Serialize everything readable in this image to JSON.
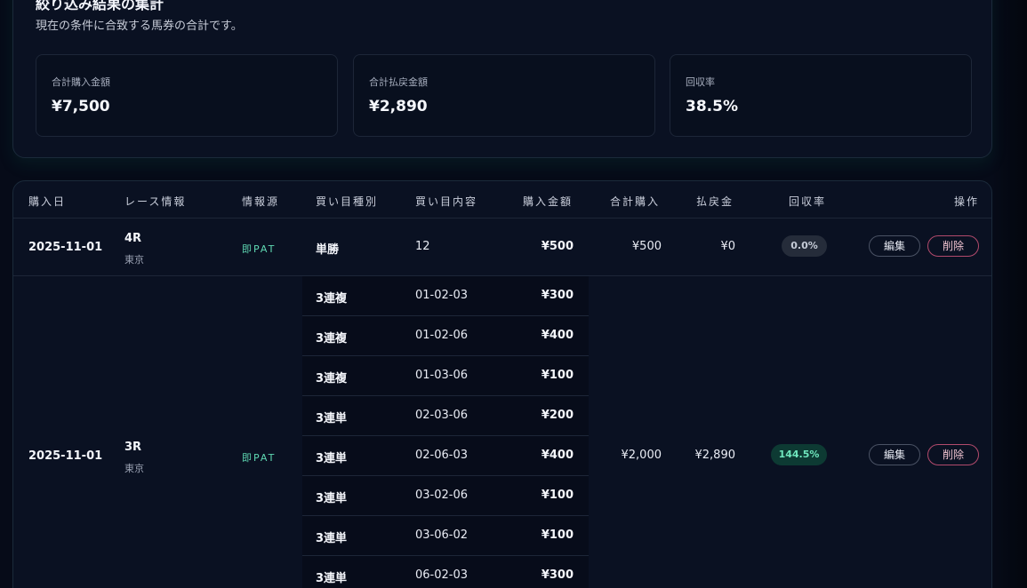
{
  "summary": {
    "title": "絞り込み結果の集計",
    "subtitle": "現在の条件に合致する馬券の合計です。",
    "stats": [
      {
        "label": "合計購入金額",
        "value": "¥7,500"
      },
      {
        "label": "合計払戻金額",
        "value": "¥2,890"
      },
      {
        "label": "回収率",
        "value": "38.5%"
      }
    ]
  },
  "table": {
    "headers": [
      "購入日",
      "レース情報",
      "情報源",
      "買い目種別",
      "買い目内容",
      "購入金額",
      "合計購入",
      "払戻金",
      "回収率",
      "操作"
    ],
    "rows": [
      {
        "date": "2025-11-01",
        "race": "4R",
        "venue": "東京",
        "source": "即PAT",
        "bets": [
          {
            "type": "単勝",
            "content": "12",
            "amount": "¥500"
          }
        ],
        "total": "¥500",
        "payout": "¥0",
        "rate": "0.0%",
        "edit": "編集",
        "delete": "削除"
      },
      {
        "date": "2025-11-01",
        "race": "3R",
        "venue": "東京",
        "source": "即PAT",
        "bets": [
          {
            "type": "3連複",
            "content": "01-02-03",
            "amount": "¥300"
          },
          {
            "type": "3連複",
            "content": "01-02-06",
            "amount": "¥400"
          },
          {
            "type": "3連複",
            "content": "01-03-06",
            "amount": "¥100"
          },
          {
            "type": "3連単",
            "content": "02-03-06",
            "amount": "¥200"
          },
          {
            "type": "3連単",
            "content": "02-06-03",
            "amount": "¥400"
          },
          {
            "type": "3連単",
            "content": "03-02-06",
            "amount": "¥100"
          },
          {
            "type": "3連単",
            "content": "03-06-02",
            "amount": "¥100"
          },
          {
            "type": "3連単",
            "content": "06-02-03",
            "amount": "¥300"
          }
        ],
        "total": "¥2,000",
        "payout": "¥2,890",
        "rate": "144.5%",
        "edit": "編集",
        "delete": "削除"
      }
    ]
  }
}
